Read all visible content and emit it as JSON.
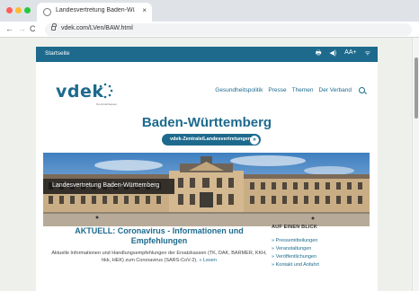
{
  "browser": {
    "tab_title": "Landesvertretung Baden-Würt",
    "close_glyph": "×",
    "back_glyph": "←",
    "forward_glyph": "→",
    "reload_glyph": "C",
    "url": "vdek.com/LVen/BAW.html"
  },
  "topbar": {
    "home_link": "Startseite",
    "icons": [
      "print-icon",
      "speaker-icon",
      "font-size-icon",
      "rss-icon"
    ],
    "font_size_label": "AA+",
    "print_glyph": "🖶",
    "speaker_glyph": "◀)",
    "rss_glyph": "ᯤ"
  },
  "header": {
    "logo_text": "vdek",
    "logo_subtitle": "Die Ersatzkassen",
    "nav": [
      "Gesundheitspolitik",
      "Presse",
      "Themen",
      "Der Verband"
    ]
  },
  "page": {
    "title": "Baden-Württemberg",
    "dropdown_label": "vdek-Zentrale/Landesvertretungen",
    "dropdown_icon": "»"
  },
  "hero": {
    "label": "Landesvertretung Baden-Württemberg"
  },
  "news": {
    "title": "AKTUELL: Coronavirus - Informationen und Empfehlungen",
    "text": "Aktuelle Informationen und Handlungsempfehlungen der Ersatzkassen (TK, DAK, BARMER, KKH, hkk, HEK) zum Coronavirus (SARS-CoV-2).",
    "more_link": "» Lesen"
  },
  "glance": {
    "heading": "AUF EINEN BLICK",
    "links": [
      "» Pressemitteilungen",
      "» Veranstaltungen",
      "» Veröffentlichungen",
      "» Kontakt und Anfahrt"
    ]
  },
  "colors": {
    "brand": "#1d6a8d",
    "page_bg": "#eef0ec"
  }
}
